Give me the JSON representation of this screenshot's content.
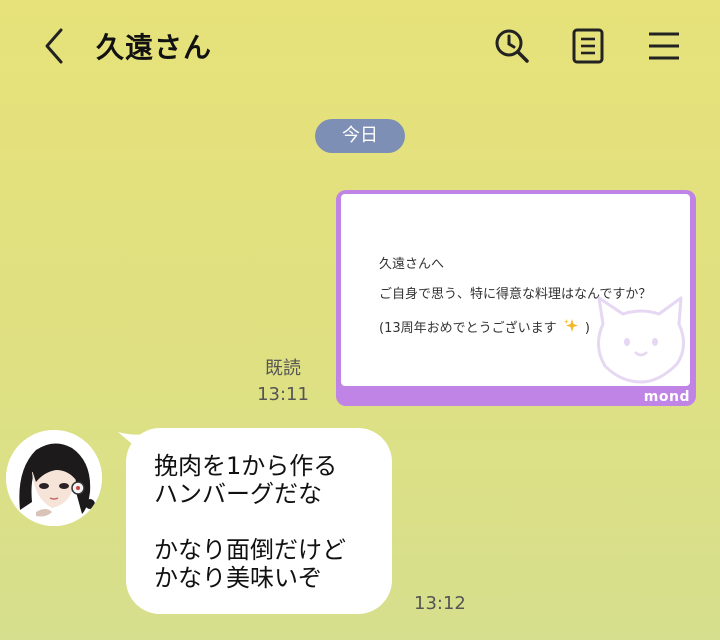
{
  "header": {
    "title": "久遠さん",
    "back_icon": "chevron-left-icon",
    "search_icon": "search-icon",
    "notes_icon": "notes-icon",
    "menu_icon": "menu-icon"
  },
  "date_separator": "今日",
  "sent_message": {
    "read_label": "既読",
    "time": "13:11",
    "card": {
      "line1": "久遠さんへ",
      "line2": "ご自身で思う、特に得意な料理はなんですか？",
      "line3": "(13周年おめでとうございます",
      "line3_end": ")",
      "sparkle_icon": "sparkles-icon",
      "brand": "mond",
      "frame_color": "#c083e6"
    }
  },
  "received_message": {
    "avatar_icon": "avatar",
    "lines": [
      "挽肉を1から作る",
      "ハンバーグだな",
      "",
      "かなり面倒だけど",
      "かなり美味いぞ"
    ],
    "time": "13:12"
  },
  "colors": {
    "background": "#e3e07f",
    "date_pill": "#7e8fb5",
    "bubble": "#ffffff"
  }
}
